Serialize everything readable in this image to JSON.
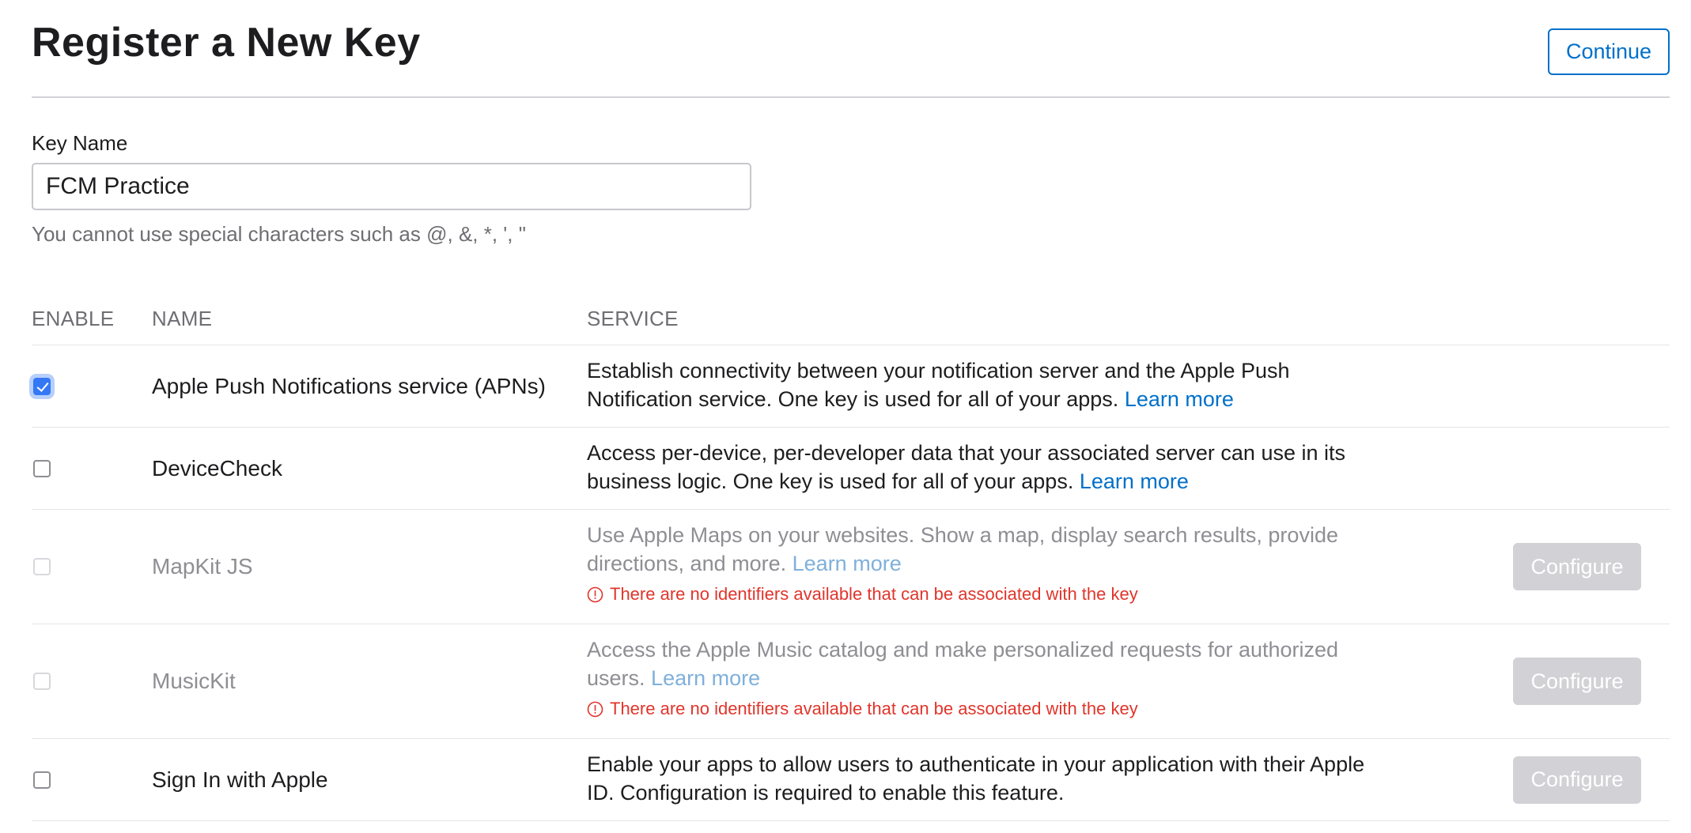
{
  "header": {
    "title": "Register a New Key",
    "continue_label": "Continue"
  },
  "key_name": {
    "label": "Key Name",
    "value": "FCM Practice",
    "hint": "You cannot use special characters such as @, &, *, ', \""
  },
  "table": {
    "columns": [
      "ENABLE",
      "NAME",
      "SERVICE"
    ],
    "rows": [
      {
        "name": "Apple Push Notifications service (APNs)",
        "checked": true,
        "disabled": false,
        "description": "Establish connectivity between your notification server and the Apple Push Notification service. One key is used for all of your apps.",
        "learn_more": "Learn more"
      },
      {
        "name": "DeviceCheck",
        "checked": false,
        "disabled": false,
        "description": "Access per-device, per-developer data that your associated server can use in its business logic. One key is used for all of your apps.",
        "learn_more": "Learn more"
      },
      {
        "name": "MapKit JS",
        "checked": false,
        "disabled": true,
        "description": "Use Apple Maps on your websites. Show a map, display search results, provide directions, and more.",
        "learn_more": "Learn more",
        "warning": "There are no identifiers available that can be associated with the key",
        "configure_label": "Configure"
      },
      {
        "name": "MusicKit",
        "checked": false,
        "disabled": true,
        "description": "Access the Apple Music catalog and make personalized requests for authorized users.",
        "learn_more": "Learn more",
        "warning": "There are no identifiers available that can be associated with the key",
        "configure_label": "Configure"
      },
      {
        "name": "Sign In with Apple",
        "checked": false,
        "disabled": false,
        "description": "Enable your apps to allow users to authenticate in your application with their Apple ID. Configuration is required to enable this feature.",
        "configure_label": "Configure"
      }
    ]
  },
  "colors": {
    "accent": "#0070c9",
    "checkbox_checked": "#3478f6",
    "warning": "#e0352b",
    "button_disabled": "#d1d1d6"
  },
  "icons": {
    "checkmark": "checkmark-icon",
    "warning": "exclamation-circle-icon"
  }
}
